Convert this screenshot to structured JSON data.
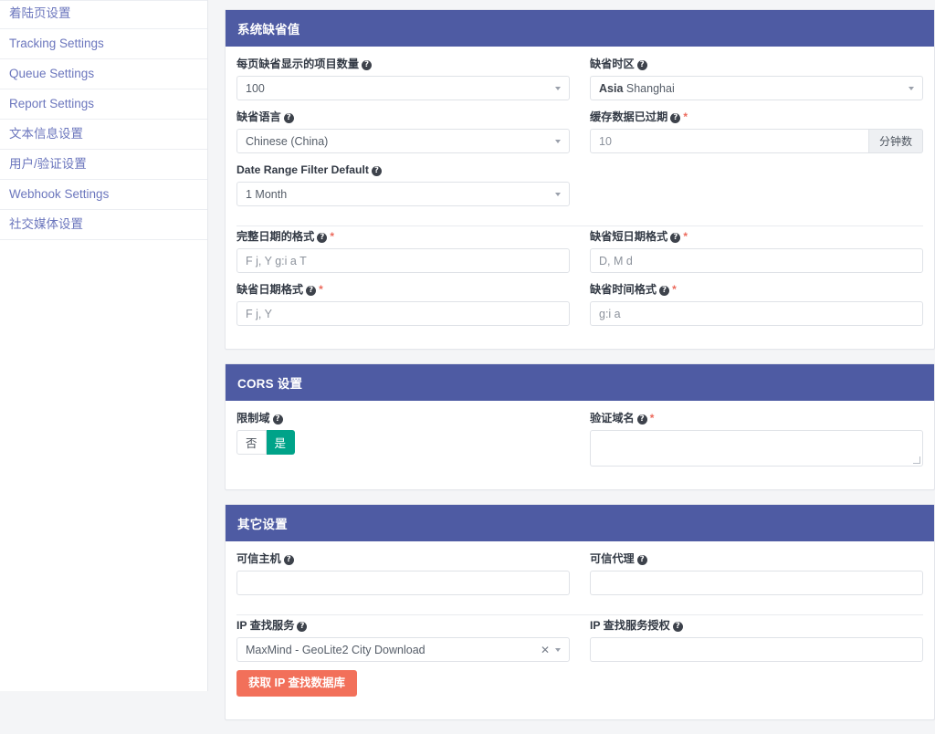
{
  "sidebar": {
    "items": [
      {
        "label": "着陆页设置"
      },
      {
        "label": "Tracking Settings"
      },
      {
        "label": "Queue Settings"
      },
      {
        "label": "Report Settings"
      },
      {
        "label": "文本信息设置"
      },
      {
        "label": "用户/验证设置"
      },
      {
        "label": "Webhook Settings"
      },
      {
        "label": "社交媒体设置"
      }
    ]
  },
  "icons": {
    "help": "?",
    "clear": "✕"
  },
  "colors": {
    "card_header": "#4e5ba3",
    "toggle_active": "#00a389",
    "primary_button": "#f2705a",
    "required_marker": "#ec6a5c"
  },
  "sections": [
    {
      "title": "系统缺省值",
      "fields": {
        "per_page": {
          "label": "每页缺省显示的项目数量",
          "required": false,
          "value": "100",
          "type": "select"
        },
        "timezone": {
          "label": "缺省时区",
          "required": false,
          "value_bold": "Asia",
          "value_rest": "Shanghai",
          "type": "select"
        },
        "language": {
          "label": "缺省语言",
          "required": false,
          "value": "Chinese (China)",
          "type": "select"
        },
        "cache_expire": {
          "label": "缓存数据已过期",
          "required": true,
          "value": "10",
          "addon": "分钟数",
          "type": "input-group"
        },
        "date_range": {
          "label": "Date Range Filter Default",
          "required": false,
          "value": "1 Month",
          "type": "select"
        },
        "full_date_format": {
          "label": "完整日期的格式",
          "required": true,
          "value": "F j, Y g:i a T",
          "type": "text"
        },
        "short_date_format": {
          "label": "缺省短日期格式",
          "required": true,
          "value": "D, M d",
          "type": "text"
        },
        "default_date_format": {
          "label": "缺省日期格式",
          "required": true,
          "value": "F j, Y",
          "type": "text"
        },
        "default_time_format": {
          "label": "缺省时间格式",
          "required": true,
          "value": "g:i a",
          "type": "text"
        }
      }
    },
    {
      "title": "CORS 设置",
      "fields": {
        "restrict_domain": {
          "label": "限制域",
          "required": false,
          "options": [
            "否",
            "是"
          ],
          "selected": "是",
          "type": "toggle"
        },
        "valid_domains": {
          "label": "验证域名",
          "required": true,
          "value": "",
          "type": "textarea"
        }
      }
    },
    {
      "title": "其它设置",
      "fields": {
        "trusted_hosts": {
          "label": "可信主机",
          "required": false,
          "value": "",
          "type": "text"
        },
        "trusted_proxies": {
          "label": "可信代理",
          "required": false,
          "value": "",
          "type": "text"
        },
        "ip_lookup_service": {
          "label": "IP 查找服务",
          "required": false,
          "value": "MaxMind - GeoLite2 City Download",
          "type": "select-clearable"
        },
        "ip_lookup_auth": {
          "label": "IP 查找服务授权",
          "required": false,
          "value": "",
          "type": "text"
        },
        "fetch_button": {
          "label": "获取 IP 查找数据库"
        }
      }
    }
  ]
}
